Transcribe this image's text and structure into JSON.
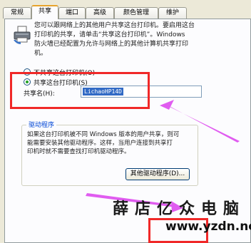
{
  "tabs": [
    {
      "label": "常规",
      "active": false
    },
    {
      "label": "共享",
      "active": true
    },
    {
      "label": "端口",
      "active": false
    },
    {
      "label": "高级",
      "active": false
    },
    {
      "label": "颜色管理",
      "active": false
    },
    {
      "label": "维护",
      "active": false
    }
  ],
  "description": {
    "line1": "您可以跟网络上的其他用户共享这台打印机。要启用这台",
    "line2": "打印机的共享，请单击“共享这台打印机”。Windows",
    "line3": "防火墙已经配置为允许与网络上的其他计算机共享打印",
    "line4": "机。"
  },
  "sharing": {
    "no_share_label": "不共享这台打印机(O)",
    "share_label": "共享这台打印机(S)",
    "share_selected": true,
    "share_name_label": "共享名(H):",
    "share_name_value": "LichaoHP14D"
  },
  "drivers": {
    "group_title": "驱动程序",
    "line1": "如果这台打印机被不同 Windows 版本的用户共享，则可",
    "line2": "能需要安装其他驱动程序。这样，当用户连接到共享打",
    "line3": "印机时就不需要查找打印机驱动程序。",
    "additional_drivers_button": "其他驱动程序(D)..."
  },
  "watermark": {
    "chinese": "薛店亿众电脑",
    "url": "www.yzdn.net"
  },
  "colors": {
    "highlight_red": "#f02828",
    "arrow_magenta": "#e05cf0",
    "active_tab_accent": "#e7a32c",
    "selection_blue": "#316ac5"
  }
}
